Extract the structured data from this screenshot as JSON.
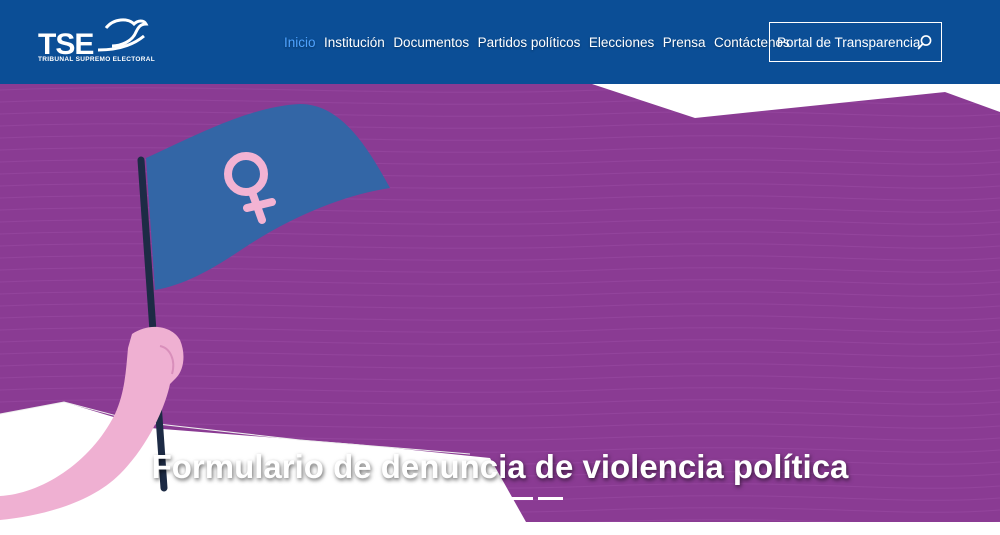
{
  "header": {
    "logo_text": "TSE",
    "logo_subtitle": "TRIBUNAL SUPREMO ELECTORAL",
    "nav_items": [
      {
        "label": "Inicio",
        "active": true
      },
      {
        "label": "Institución"
      },
      {
        "label": "Documentos"
      },
      {
        "label": "Partidos políticos"
      },
      {
        "label": "Elecciones"
      },
      {
        "label": "Prensa"
      },
      {
        "label": "Contáctenos"
      }
    ],
    "portal_label": "Portal de Transparencia",
    "search_icon": "search-icon"
  },
  "hero": {
    "title": "Formulario de denuncia de violencia política",
    "slide_count": 3,
    "colors": {
      "background": "#8a3b93",
      "flag": "#3366a6",
      "female_symbol": "#f3b3d3",
      "arm": "#efb0d2",
      "pole": "#1d2b45"
    }
  },
  "colors": {
    "header_bg": "#0b4e96",
    "nav_active": "#4fa3ff",
    "nav_text": "#ffffff"
  }
}
